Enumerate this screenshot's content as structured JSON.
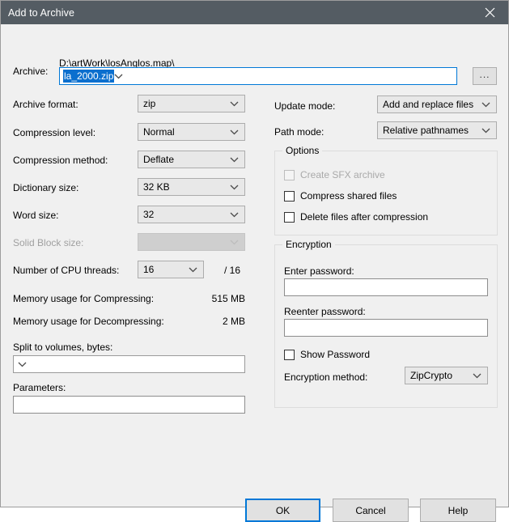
{
  "window": {
    "title": "Add to Archive",
    "close_icon": "close-icon"
  },
  "archive": {
    "label": "Archive:",
    "path": "D:\\artWork\\losAnglos.map\\",
    "filename": "la_2000.zip",
    "browse_label": "...",
    "dropdown_icon": "chevron-down-icon"
  },
  "left": {
    "archive_format": {
      "label": "Archive format:",
      "value": "zip"
    },
    "compression_level": {
      "label": "Compression level:",
      "value": "Normal"
    },
    "compression_method": {
      "label": "Compression method:",
      "value": "Deflate"
    },
    "dictionary_size": {
      "label": "Dictionary size:",
      "value": "32 KB"
    },
    "word_size": {
      "label": "Word size:",
      "value": "32"
    },
    "solid_block_size": {
      "label": "Solid Block size:",
      "value": ""
    },
    "cpu_threads": {
      "label": "Number of CPU threads:",
      "value": "16",
      "total": "/ 16"
    },
    "memory_compress": {
      "label": "Memory usage for Compressing:",
      "value": "515 MB"
    },
    "memory_decompress": {
      "label": "Memory usage for Decompressing:",
      "value": "2 MB"
    },
    "split_volumes": {
      "label": "Split to volumes, bytes:",
      "value": ""
    },
    "parameters": {
      "label": "Parameters:",
      "value": ""
    }
  },
  "right": {
    "update_mode": {
      "label": "Update mode:",
      "value": "Add and replace files"
    },
    "path_mode": {
      "label": "Path mode:",
      "value": "Relative pathnames"
    },
    "options": {
      "title": "Options",
      "items": [
        {
          "label": "Create SFX archive",
          "checked": false,
          "disabled": true
        },
        {
          "label": "Compress shared files",
          "checked": false,
          "disabled": false
        },
        {
          "label": "Delete files after compression",
          "checked": false,
          "disabled": false
        }
      ]
    },
    "encryption": {
      "title": "Encryption",
      "enter_password": {
        "label": "Enter password:",
        "value": ""
      },
      "reenter_password": {
        "label": "Reenter password:",
        "value": ""
      },
      "show_password": {
        "label": "Show Password",
        "checked": false
      },
      "method": {
        "label": "Encryption method:",
        "value": "ZipCrypto"
      }
    }
  },
  "footer": {
    "ok": "OK",
    "cancel": "Cancel",
    "help": "Help"
  },
  "colors": {
    "titlebar": "#545c63",
    "dialog_bg": "#f0f0f0",
    "accent": "#0078d7",
    "selection": "#0b6fce"
  }
}
